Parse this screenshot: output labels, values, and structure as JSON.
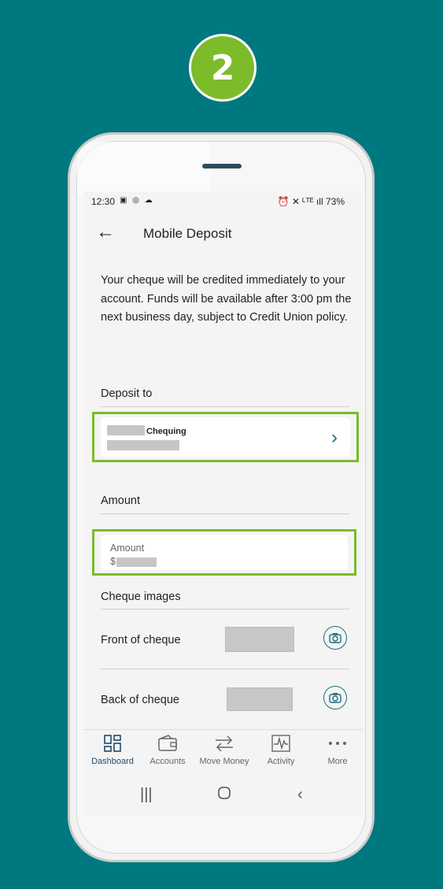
{
  "step": {
    "number": "2"
  },
  "status_bar": {
    "time": "12:30",
    "left_icons": "▣ ◎ ☁",
    "right": "⏰ ✕ ᴸᵀᴱ ıll 73%"
  },
  "header": {
    "title": "Mobile Deposit"
  },
  "description": "Your cheque will be credited immediately to your account. Funds will be available after 3:00 pm the next business day, subject to Credit Union policy.",
  "deposit_to": {
    "label": "Deposit to",
    "account_type": "Chequing"
  },
  "amount": {
    "label": "Amount",
    "field_label": "Amount",
    "currency_prefix": "$"
  },
  "cheque_images": {
    "label": "Cheque images",
    "front_label": "Front of cheque",
    "back_label": "Back of cheque"
  },
  "nav": {
    "items": [
      {
        "label": "Dashboard",
        "icon": "dashboard-icon"
      },
      {
        "label": "Accounts",
        "icon": "wallet-icon"
      },
      {
        "label": "Move Money",
        "icon": "transfer-icon"
      },
      {
        "label": "Activity",
        "icon": "activity-icon"
      },
      {
        "label": "More",
        "icon": "more-icon"
      }
    ]
  },
  "colors": {
    "background": "#00787f",
    "accent_green": "#7cbb2a",
    "teal": "#1c6e7a"
  }
}
